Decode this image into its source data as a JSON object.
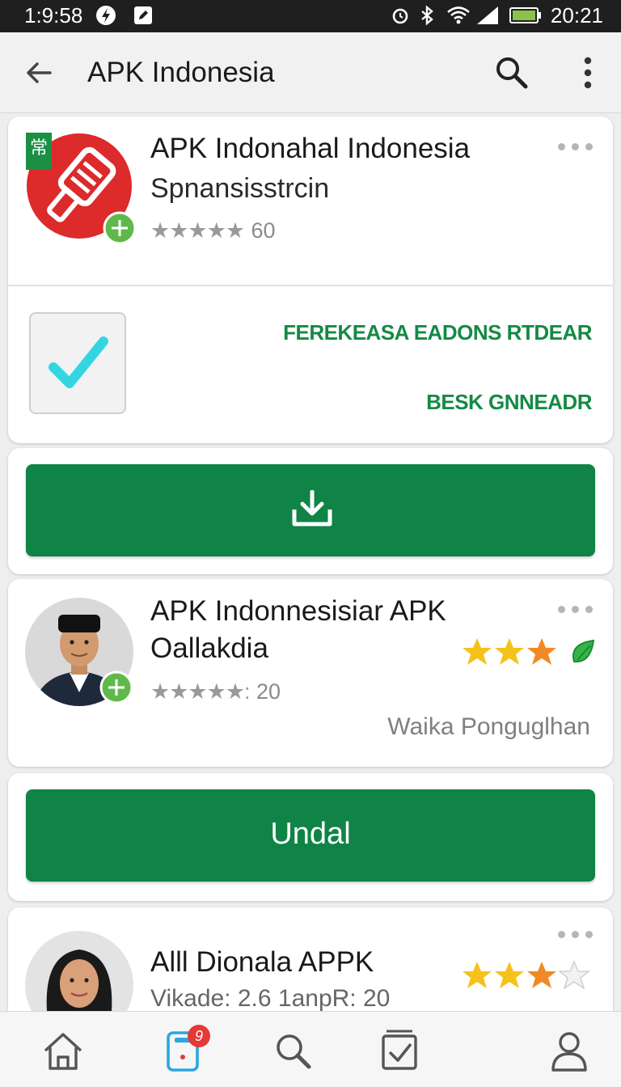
{
  "status_bar": {
    "time": "1:9:58",
    "clock": "20:21"
  },
  "app_bar": {
    "title": "APK Indonesia"
  },
  "card1": {
    "title": "APK Indonahal Indonesia",
    "subtitle": "Spnansisstrcin",
    "stars": "★★★★★",
    "rating_count": "60",
    "action_primary": "FEREKEASA  EADONS RTDEAR",
    "action_secondary": "BESK GNNEADR",
    "checkbox_checked": true
  },
  "card2": {
    "title_line1": "APK Indonnesisiar APK",
    "title_line2": "Oallakdia",
    "stars": "★★★★★:",
    "rating_count": "20",
    "meta": "Waika Ponguglhan"
  },
  "card3": {
    "button_label": "Undal"
  },
  "card4": {
    "title": "Alll Dionala APPK",
    "meta": "Vikade: 2.6 1anpR: 20"
  },
  "colors": {
    "accent_green": "#0f8446",
    "text_green": "#148a44",
    "badge_red": "#e53935",
    "cyan_check": "#33d6e0"
  },
  "bottom_nav": {
    "badge_count": "9"
  }
}
